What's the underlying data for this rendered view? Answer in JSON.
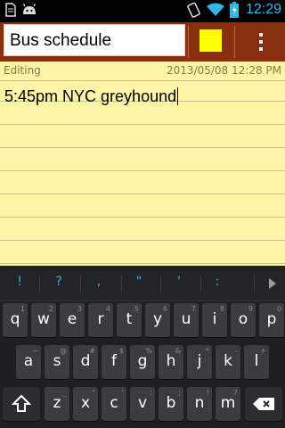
{
  "status_bar": {
    "time": "12:29",
    "left_icons": [
      "document-icon",
      "android-icon"
    ],
    "right_icons": [
      "rotation-icon",
      "wifi-icon",
      "battery-icon"
    ]
  },
  "header": {
    "title_value": "Bus schedule",
    "note_color": "#ffff00",
    "menu_icon": "overflow-menu-icon",
    "background": "#8a2f0d"
  },
  "note": {
    "status": "Editing",
    "datetime": "2013/05/08 12:28 PM",
    "body": "5:45pm NYC greyhound",
    "background": "#fdf4a6"
  },
  "keyboard": {
    "suggestions": [
      "!",
      "?",
      ",",
      "\"",
      "'",
      ":"
    ],
    "row1": [
      {
        "key": "q",
        "hint": "1"
      },
      {
        "key": "w",
        "hint": "2"
      },
      {
        "key": "e",
        "hint": "3"
      },
      {
        "key": "r",
        "hint": "4"
      },
      {
        "key": "t",
        "hint": "5"
      },
      {
        "key": "y",
        "hint": "6"
      },
      {
        "key": "u",
        "hint": "7"
      },
      {
        "key": "i",
        "hint": "8"
      },
      {
        "key": "o",
        "hint": "9"
      },
      {
        "key": "p",
        "hint": "0"
      }
    ],
    "row2": [
      {
        "key": "a",
        "hint": "~"
      },
      {
        "key": "s",
        "hint": "@"
      },
      {
        "key": "d",
        "hint": "#"
      },
      {
        "key": "f",
        "hint": "$"
      },
      {
        "key": "g",
        "hint": "%"
      },
      {
        "key": "h",
        "hint": "&"
      },
      {
        "key": "j",
        "hint": "*"
      },
      {
        "key": "k",
        "hint": "-"
      },
      {
        "key": "l",
        "hint": "+"
      }
    ],
    "row3": [
      {
        "key": "z",
        "hint": "_"
      },
      {
        "key": "x",
        "hint": "\""
      },
      {
        "key": "c",
        "hint": "'"
      },
      {
        "key": "v",
        "hint": ":"
      },
      {
        "key": "b",
        "hint": ";"
      },
      {
        "key": "n",
        "hint": "!"
      },
      {
        "key": "m",
        "hint": "?"
      }
    ],
    "shift_icon": "shift-icon",
    "delete_icon": "backspace-icon"
  }
}
